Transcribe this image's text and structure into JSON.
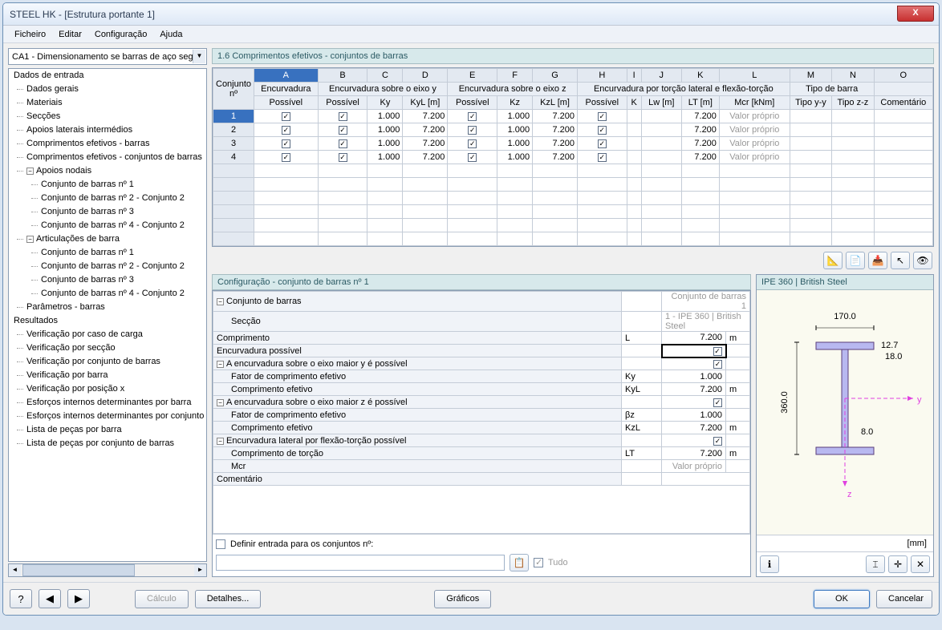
{
  "window": {
    "title": "STEEL HK - [Estrutura portante 1]"
  },
  "menu": {
    "file": "Ficheiro",
    "edit": "Editar",
    "config": "Configuração",
    "help": "Ajuda"
  },
  "combo": {
    "text": "CA1 - Dimensionamento se barras de aço segu"
  },
  "tree": {
    "root1": "Dados de entrada",
    "i1": "Dados gerais",
    "i2": "Materiais",
    "i3": "Secções",
    "i4": "Apoios laterais intermédios",
    "i5": "Comprimentos efetivos - barras",
    "i6": "Comprimentos efetivos - conjuntos de barras",
    "i7": "Apoios nodais",
    "i7a": "Conjunto de barras nº 1",
    "i7b": "Conjunto de barras nº 2 - Conjunto 2",
    "i7c": "Conjunto de barras nº 3",
    "i7d": "Conjunto de barras nº 4 - Conjunto 2",
    "i8": "Articulações de barra",
    "i8a": "Conjunto de barras nº 1",
    "i8b": "Conjunto de barras nº 2 - Conjunto 2",
    "i8c": "Conjunto de barras nº 3",
    "i8d": "Conjunto de barras nº 4 - Conjunto 2",
    "i9": "Parâmetros - barras",
    "root2": "Resultados",
    "r1": "Verificação por caso de carga",
    "r2": "Verificação por secção",
    "r3": "Verificação por conjunto de barras",
    "r4": "Verificação por barra",
    "r5": "Verificação por posição x",
    "r6": "Esforços internos determinantes por barra",
    "r7": "Esforços internos determinantes por conjunto",
    "r8": "Lista de peças por barra",
    "r9": "Lista de peças por conjunto de barras"
  },
  "section": {
    "title": "1.6 Comprimentos efetivos - conjuntos de barras"
  },
  "grid": {
    "colletters": [
      "A",
      "B",
      "C",
      "D",
      "E",
      "F",
      "G",
      "H",
      "I",
      "J",
      "K",
      "L",
      "M",
      "N",
      "O"
    ],
    "corner": "Conjunto nº",
    "groups": {
      "g1": "Encurvadura",
      "g2": "Encurvadura sobre o eixo y",
      "g3": "Encurvadura sobre o eixo z",
      "g4": "Encurvadura por torção lateral e flexão-torção",
      "g5": "Tipo de barra",
      "g6": ""
    },
    "cols": {
      "c1": "Possível",
      "c2": "Possível",
      "c3": "Ky",
      "c4": "KyL [m]",
      "c5": "Possível",
      "c6": "Kz",
      "c7": "KzL [m]",
      "c8": "Possível",
      "c9": "K",
      "c10": "Lw [m]",
      "c11": "LT [m]",
      "c12": "Mcr [kNm]",
      "c13": "Tipo y-y",
      "c14": "Tipo z-z",
      "c15": "Comentário"
    },
    "rows": [
      {
        "n": "1",
        "a": true,
        "b": true,
        "ky": "1.000",
        "kyl": "7.200",
        "e": true,
        "kz": "1.000",
        "kzl": "7.200",
        "h": true,
        "lt": "7.200",
        "mcr": "Valor próprio"
      },
      {
        "n": "2",
        "a": true,
        "b": true,
        "ky": "1.000",
        "kyl": "7.200",
        "e": true,
        "kz": "1.000",
        "kzl": "7.200",
        "h": true,
        "lt": "7.200",
        "mcr": "Valor próprio"
      },
      {
        "n": "3",
        "a": true,
        "b": true,
        "ky": "1.000",
        "kyl": "7.200",
        "e": true,
        "kz": "1.000",
        "kzl": "7.200",
        "h": true,
        "lt": "7.200",
        "mcr": "Valor próprio"
      },
      {
        "n": "4",
        "a": true,
        "b": true,
        "ky": "1.000",
        "kyl": "7.200",
        "e": true,
        "kz": "1.000",
        "kzl": "7.200",
        "h": true,
        "lt": "7.200",
        "mcr": "Valor próprio"
      }
    ]
  },
  "config": {
    "title": "Configuração - conjunto de barras nº 1",
    "rows": {
      "r1l": "Conjunto de barras",
      "r1v": "Conjunto de barras 1",
      "r2l": "Secção",
      "r2v": "1 - IPE 360 | British Steel",
      "r3l": "Comprimento",
      "r3s": "L",
      "r3v": "7.200",
      "r3u": "m",
      "r4l": "Encurvadura possível",
      "r5l": "A encurvadura sobre o eixo maior y é possível",
      "r6l": "Fator de comprimento efetivo",
      "r6s": "Ky",
      "r6v": "1.000",
      "r7l": "Comprimento efetivo",
      "r7s": "KyL",
      "r7v": "7.200",
      "r7u": "m",
      "r8l": "A encurvadura sobre o eixo maior z é possível",
      "r9l": "Fator de comprimento efetivo",
      "r9s": "βz",
      "r9v": "1.000",
      "r10l": "Comprimento efetivo",
      "r10s": "KzL",
      "r10v": "7.200",
      "r10u": "m",
      "r11l": "Encurvadura lateral por flexão-torção possível",
      "r12l": "Comprimento de torção",
      "r12s": "LT",
      "r12v": "7.200",
      "r12u": "m",
      "r13l": "Mcr",
      "r13v": "Valor próprio",
      "r14l": "Comentário"
    },
    "define": "Definir entrada para os conjuntos nº:",
    "tudo": "Tudo"
  },
  "preview": {
    "title": "IPE 360 | British Steel",
    "d170": "170.0",
    "d360": "360.0",
    "d127": "12.7",
    "d18": "18.0",
    "d8": "8.0",
    "y": "y",
    "z": "z",
    "mm": "[mm]"
  },
  "buttons": {
    "calc": "Cálculo",
    "details": "Detalhes...",
    "graphics": "Gráficos",
    "ok": "OK",
    "cancel": "Cancelar"
  }
}
